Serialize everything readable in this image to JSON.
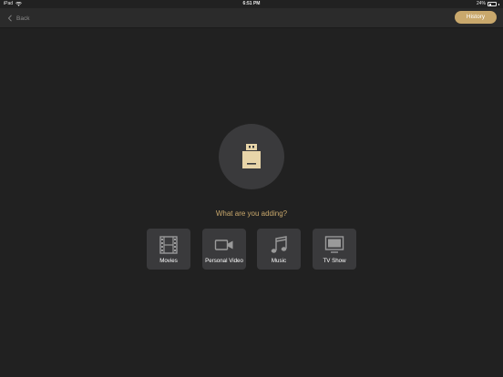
{
  "status_bar": {
    "device": "iPad",
    "time": "6:51 PM",
    "battery": "24%"
  },
  "nav": {
    "back_label": "Back",
    "history_label": "History"
  },
  "main": {
    "prompt": "What are you adding?",
    "types": [
      {
        "label": "Movies",
        "icon": "film-icon"
      },
      {
        "label": "Personal Video",
        "icon": "video-camera-icon"
      },
      {
        "label": "Music",
        "icon": "music-note-icon"
      },
      {
        "label": "TV Show",
        "icon": "tv-icon"
      }
    ]
  },
  "colors": {
    "background": "#212121",
    "nav_background": "#2b2b2b",
    "accent": "#c9a86c",
    "tile": "#3a3a3c"
  }
}
